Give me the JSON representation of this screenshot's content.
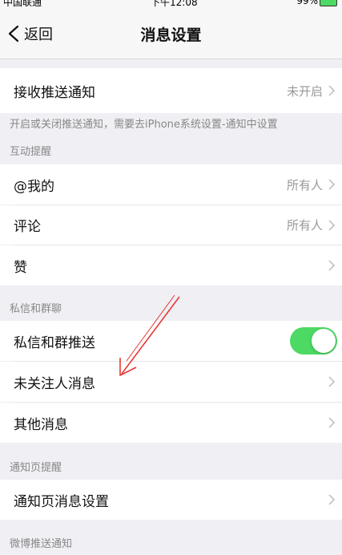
{
  "status_bar": {
    "carrier": "中国联通",
    "time": "下午12:08",
    "battery": "99%"
  },
  "nav": {
    "back_label": "返回",
    "title": "消息设置"
  },
  "push": {
    "label": "接收推送通知",
    "value": "未开启",
    "note": "开启或关闭推送通知，需要去iPhone系统设置-通知中设置"
  },
  "interaction": {
    "section_title": "互动提醒",
    "items": [
      {
        "label": "@我的",
        "value": "所有人"
      },
      {
        "label": "评论",
        "value": "所有人"
      },
      {
        "label": "赞",
        "value": ""
      }
    ]
  },
  "private": {
    "section_title": "私信和群聊",
    "toggle_label": "私信和群推送",
    "toggle_on": true,
    "items": [
      {
        "label": "未关注人消息"
      },
      {
        "label": "其他消息"
      }
    ]
  },
  "notify_page": {
    "section_title": "通知页提醒",
    "item_label": "通知页消息设置"
  },
  "weibo_push": {
    "section_title": "微博推送通知"
  },
  "colors": {
    "toggle_on": "#4cd964",
    "annotation_arrow": "#e53935"
  }
}
